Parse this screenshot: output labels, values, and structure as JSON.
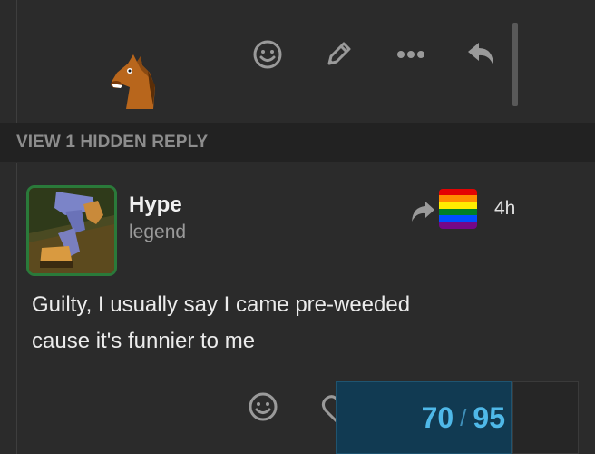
{
  "top_post": {
    "actions": [
      {
        "name": "like-button",
        "icon": "smile-icon"
      },
      {
        "name": "edit-button",
        "icon": "pencil-icon"
      },
      {
        "name": "more-button",
        "icon": "ellipsis-icon"
      },
      {
        "name": "reply-button",
        "icon": "reply-icon"
      }
    ],
    "avatar_icon": "horse-emoji-icon"
  },
  "hidden_replies": {
    "label": "VIEW 1 HIDDEN REPLY"
  },
  "post": {
    "username": "Hype",
    "user_title": "legend",
    "reply_icon": "share-arrow-icon",
    "flag_icon": "rainbow-flag-icon",
    "time": "4h",
    "body_line1": "Guilty, I usually say I came pre-weeded",
    "body_line2": "cause it's funnier to me"
  },
  "progress": {
    "current": "70",
    "separator": "/",
    "total": "95"
  },
  "colors": {
    "background": "#2b2b2b",
    "accent_blue": "#4fb8e8",
    "avatar_border": "#2a7a3a",
    "hidden_bar": "#222222"
  }
}
